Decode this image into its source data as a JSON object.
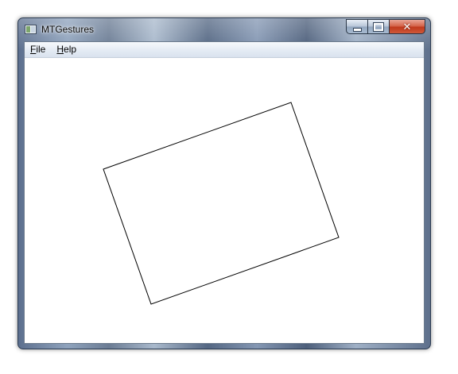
{
  "window": {
    "title": "MTGestures",
    "minimize_label": "",
    "maximize_label": "",
    "close_label": "✕"
  },
  "menu": {
    "file": {
      "accel": "F",
      "rest": "ile"
    },
    "help": {
      "accel": "H",
      "rest": "elp"
    }
  },
  "colors": {
    "client_background": "#ffffff",
    "shape_stroke": "#000000",
    "close_button": "#c7432a"
  },
  "icons": {
    "app": "app-window-icon",
    "minimize": "minimize-icon",
    "maximize": "maximize-icon",
    "close": "close-icon"
  }
}
